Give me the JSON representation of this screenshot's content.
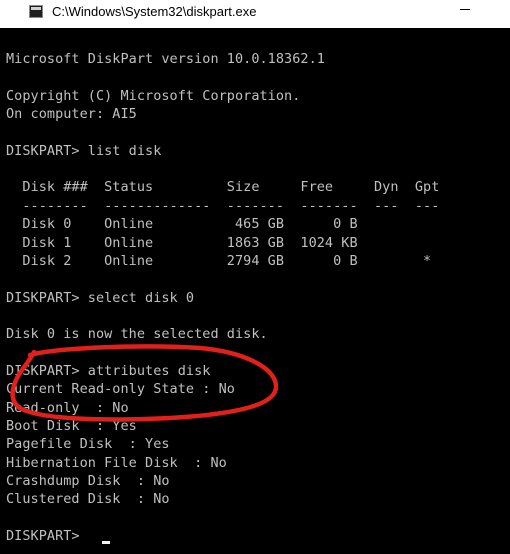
{
  "window": {
    "title": "C:\\Windows\\System32\\diskpart.exe",
    "icon": "console-app-icon",
    "minimize_icon": "minimize-icon"
  },
  "console": {
    "lines": [
      "Microsoft DiskPart version 10.0.18362.1",
      "",
      "Copyright (C) Microsoft Corporation.",
      "On computer: AI5",
      "",
      "DISKPART> list disk",
      "",
      "  Disk ###  Status         Size     Free     Dyn  Gpt",
      "  --------  -------------  -------  -------  ---  ---",
      "  Disk 0    Online          465 GB      0 B",
      "  Disk 1    Online         1863 GB  1024 KB",
      "  Disk 2    Online         2794 GB      0 B        *",
      "",
      "DISKPART> select disk 0",
      "",
      "Disk 0 is now the selected disk.",
      "",
      "DISKPART> attributes disk",
      "Current Read-only State : No",
      "Read-only  : No",
      "Boot Disk  : Yes",
      "Pagefile Disk  : Yes",
      "Hibernation File Disk  : No",
      "Crashdump Disk  : No",
      "Clustered Disk  : No",
      "",
      "DISKPART> "
    ]
  },
  "annotation": {
    "color": "#e0201b",
    "shape": "hand-drawn-ellipse"
  }
}
